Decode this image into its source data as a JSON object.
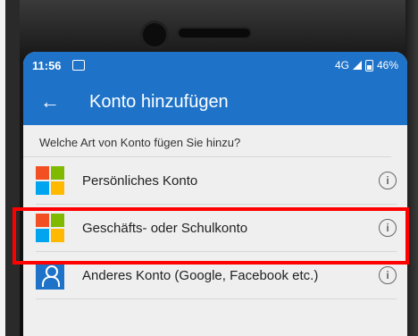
{
  "status_bar": {
    "time": "11:56",
    "network": "4G",
    "battery": "46%"
  },
  "app_bar": {
    "back_icon": "arrow-left-icon",
    "title": "Konto hinzufügen"
  },
  "prompt": "Welche Art von Konto fügen Sie hinzu?",
  "accounts": [
    {
      "label": "Persönliches Konto",
      "icon": "microsoft-logo-icon"
    },
    {
      "label": "Geschäfts- oder Schulkonto",
      "icon": "microsoft-logo-icon",
      "highlighted": true
    },
    {
      "label": "Anderes Konto (Google, Facebook etc.)",
      "icon": "person-icon"
    }
  ],
  "colors": {
    "accent": "#1e73c8",
    "highlight": "#ff0000"
  }
}
